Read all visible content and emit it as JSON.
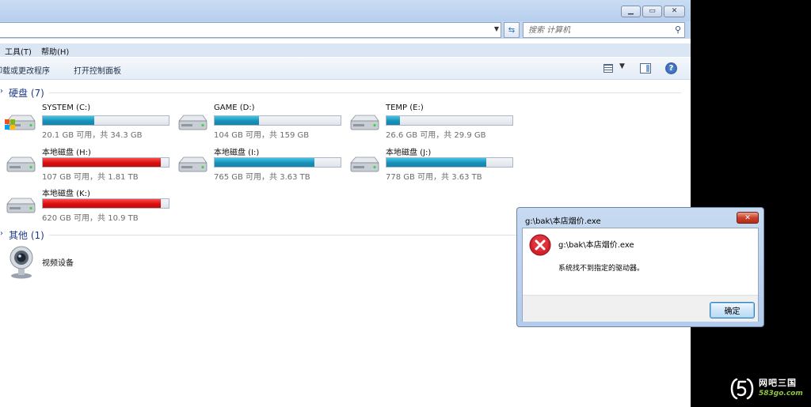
{
  "search": {
    "placeholder": "搜索 计算机"
  },
  "menu": {
    "items": [
      "工具(T)",
      "帮助(H)"
    ]
  },
  "toolbar": {
    "uninstall_label": "卸载或更改程序",
    "control_panel_label": "打开控制面板"
  },
  "groups": {
    "hard_disks": {
      "title": "硬盘 (7)"
    },
    "other": {
      "title": "其他 (1)"
    }
  },
  "drives": [
    {
      "label": "SYSTEM (C:)",
      "space": "20.1 GB 可用，共 34.3 GB",
      "used_fraction": 0.41,
      "status": "normal",
      "os_drive": true
    },
    {
      "label": "GAME (D:)",
      "space": "104 GB 可用，共 159 GB",
      "used_fraction": 0.35,
      "status": "normal"
    },
    {
      "label": "TEMP (E:)",
      "space": "26.6 GB 可用，共 29.9 GB",
      "used_fraction": 0.11,
      "status": "normal"
    },
    {
      "label": "本地磁盘 (H:)",
      "space": "107 GB 可用，共 1.81 TB",
      "used_fraction": 0.94,
      "status": "full"
    },
    {
      "label": "本地磁盘 (I:)",
      "space": "765 GB 可用，共 3.63 TB",
      "used_fraction": 0.79,
      "status": "normal"
    },
    {
      "label": "本地磁盘 (J:)",
      "space": "778 GB 可用，共 3.63 TB",
      "used_fraction": 0.79,
      "status": "normal"
    },
    {
      "label": "本地磁盘 (K:)",
      "space": "620 GB 可用，共 10.9 TB",
      "used_fraction": 0.94,
      "status": "full"
    }
  ],
  "devices": [
    {
      "label": "视频设备"
    }
  ],
  "dialog": {
    "title": "g:\\bak\\本店烟价.exe",
    "filename": "g:\\bak\\本店烟价.exe",
    "message": "系统找不到指定的驱动器。",
    "ok_label": "确定"
  },
  "watermark": {
    "title": "网吧三国",
    "url": "583go.com"
  },
  "colors": {
    "bar_normal": "#1a8fb8",
    "bar_full": "#d90f0f",
    "group_header": "#1e3a87",
    "error_red": "#d3202a"
  }
}
